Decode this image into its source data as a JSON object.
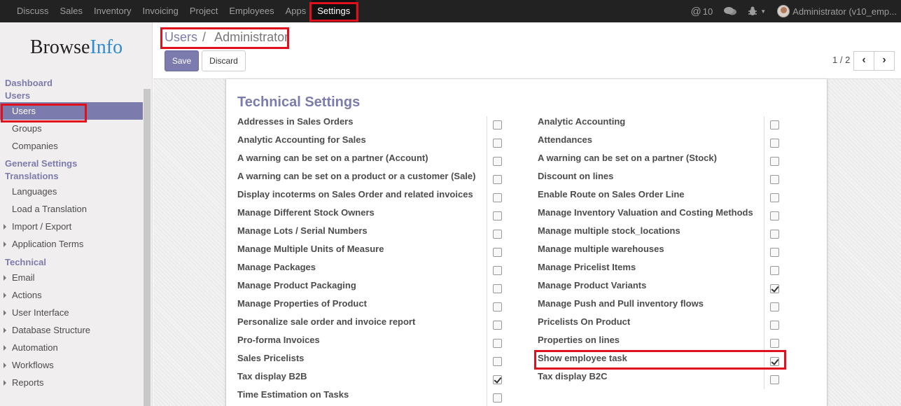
{
  "navbar": {
    "menu": [
      "Discuss",
      "Sales",
      "Inventory",
      "Invoicing",
      "Project",
      "Employees",
      "Apps",
      "Settings"
    ],
    "active": "Settings",
    "mentions_count": "10",
    "user_label": "Administrator (v10_emp..."
  },
  "sidebar": {
    "logo_part1": "Browse",
    "logo_part2": "Info",
    "sections": [
      {
        "title": "Dashboard",
        "items": []
      },
      {
        "title": "Users",
        "items": [
          "Users",
          "Groups",
          "Companies"
        ]
      },
      {
        "title": "General Settings",
        "items": []
      },
      {
        "title": "Translations",
        "items": [
          "Languages",
          "Load a Translation",
          "Import / Export",
          "Application Terms"
        ]
      },
      {
        "title": "Technical",
        "items": [
          "Email",
          "Actions",
          "User Interface",
          "Database Structure",
          "Automation",
          "Workflows",
          "Reports"
        ]
      }
    ],
    "active_item": "Users"
  },
  "control_panel": {
    "breadcrumb_parent": "Users",
    "breadcrumb_sep": "/",
    "breadcrumb_current": "Administrator",
    "save_label": "Save",
    "discard_label": "Discard",
    "pager": "1 / 2",
    "prev_icon": "‹",
    "next_icon": "›"
  },
  "form": {
    "section_title": "Technical Settings",
    "left": [
      {
        "label": "Addresses in Sales Orders",
        "checked": false
      },
      {
        "label": "Analytic Accounting for Sales",
        "checked": false
      },
      {
        "label": "A warning can be set on a partner (Account)",
        "checked": false
      },
      {
        "label": "A warning can be set on a product or a customer (Sale)",
        "checked": false
      },
      {
        "label": "Display incoterms on Sales Order and related invoices",
        "checked": false
      },
      {
        "label": "Manage Different Stock Owners",
        "checked": false
      },
      {
        "label": "Manage Lots / Serial Numbers",
        "checked": false
      },
      {
        "label": "Manage Multiple Units of Measure",
        "checked": false
      },
      {
        "label": "Manage Packages",
        "checked": false
      },
      {
        "label": "Manage Product Packaging",
        "checked": false
      },
      {
        "label": "Manage Properties of Product",
        "checked": false
      },
      {
        "label": "Personalize sale order and invoice report",
        "checked": false
      },
      {
        "label": "Pro-forma Invoices",
        "checked": false
      },
      {
        "label": "Sales Pricelists",
        "checked": false
      },
      {
        "label": "Tax display B2B",
        "checked": true
      },
      {
        "label": "Time Estimation on Tasks",
        "checked": false
      }
    ],
    "right": [
      {
        "label": "Analytic Accounting",
        "checked": false
      },
      {
        "label": "Attendances",
        "checked": false
      },
      {
        "label": "A warning can be set on a partner (Stock)",
        "checked": false
      },
      {
        "label": "Discount on lines",
        "checked": false
      },
      {
        "label": "Enable Route on Sales Order Line",
        "checked": false
      },
      {
        "label": "Manage Inventory Valuation and Costing Methods",
        "checked": false
      },
      {
        "label": "Manage multiple stock_locations",
        "checked": false
      },
      {
        "label": "Manage multiple warehouses",
        "checked": false
      },
      {
        "label": "Manage Pricelist Items",
        "checked": false
      },
      {
        "label": "Manage Product Variants",
        "checked": true
      },
      {
        "label": "Manage Push and Pull inventory flows",
        "checked": false
      },
      {
        "label": "Pricelists On Product",
        "checked": false
      },
      {
        "label": "Properties on lines",
        "checked": false
      },
      {
        "label": "Show employee task",
        "checked": true
      },
      {
        "label": "Tax display B2C",
        "checked": false
      }
    ]
  },
  "colors": {
    "accent": "#7c7bad",
    "navbar_bg": "#222222",
    "highlight": "#e0101d"
  }
}
